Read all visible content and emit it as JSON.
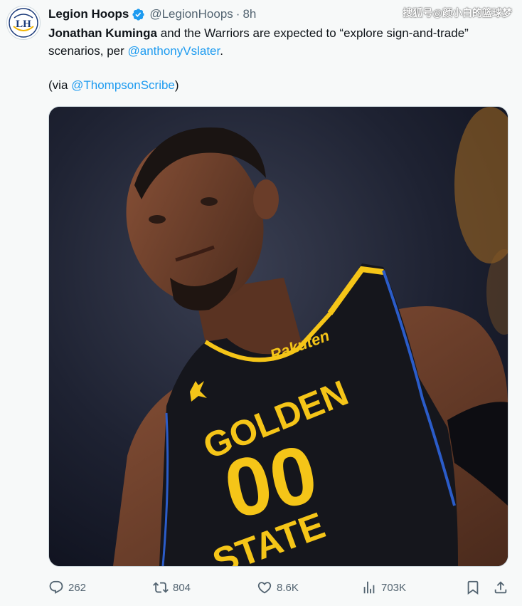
{
  "account": {
    "display_name": "Legion Hoops",
    "handle": "@LegionHoops",
    "separator": "·",
    "time": "8h",
    "avatar_letters": "LH",
    "verified_icon": "verified-badge-icon"
  },
  "watermark": "搜狐号@颜小白的篮球梦",
  "tweet": {
    "bold_name": "Jonathan Kuminga",
    "text_part1": " and the Warriors are expected to “explore sign-and-trade” scenarios, per ",
    "mention1": "@anthonyVslater",
    "text_part2": ".",
    "via_prefix": "(via ",
    "mention2": "@ThompsonScribe",
    "via_suffix": ")"
  },
  "media": {
    "jersey_sponsor": "Rakuten",
    "jersey_line1": "GOLDEN",
    "jersey_number": "00",
    "jersey_line2": "STATE"
  },
  "actions": {
    "reply": {
      "icon": "reply-icon",
      "count": "262"
    },
    "retweet": {
      "icon": "retweet-icon",
      "count": "804"
    },
    "like": {
      "icon": "heart-icon",
      "count": "8.6K"
    },
    "views": {
      "icon": "views-icon",
      "count": "703K"
    },
    "bookmark": {
      "icon": "bookmark-icon"
    },
    "share": {
      "icon": "share-icon"
    }
  },
  "colors": {
    "link": "#1d9bf0",
    "muted": "#536471",
    "text": "#0f1419",
    "jersey_gold": "#f5c518",
    "jersey_black": "#15161c"
  }
}
